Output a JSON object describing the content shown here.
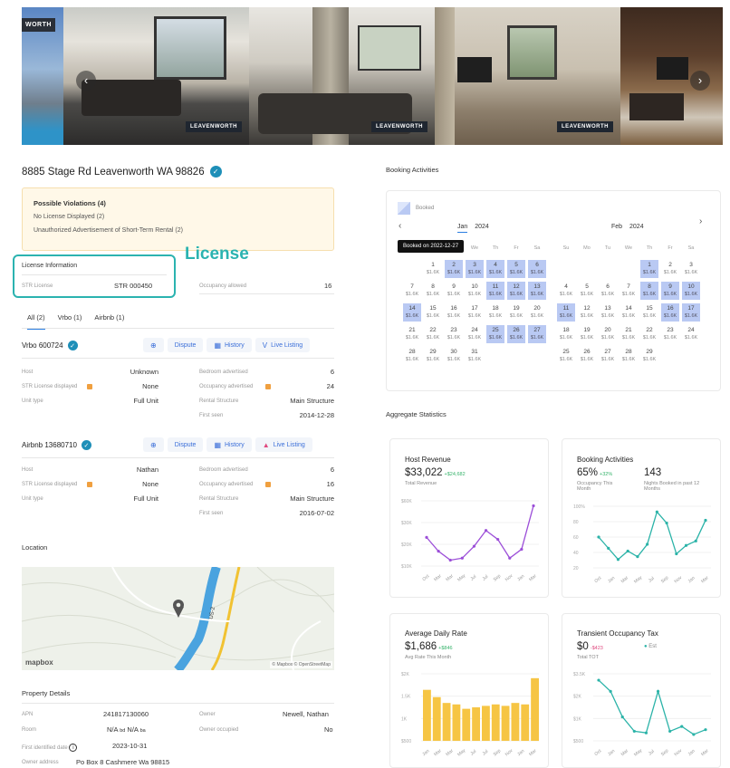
{
  "gallery": {
    "logo": "WORTH",
    "watermark": "LEAVENWORTH",
    "prev_icon": "chevron-left-icon",
    "next_icon": "chevron-right-icon"
  },
  "property": {
    "address": "8885 Stage Rd Leavenworth WA 98826"
  },
  "violations": {
    "title": "Possible Violations (4)",
    "items": [
      "No License Displayed (2)",
      "Unauthorized Advertisement of Short-Term Rental (2)"
    ]
  },
  "license_info": {
    "title": "License Information",
    "callout": "License",
    "str_license_label": "STR License",
    "str_license_value": "STR 000450",
    "occupancy_label": "Occupancy allowed",
    "occupancy_value": "16"
  },
  "tabs": [
    {
      "label": "All (2)"
    },
    {
      "label": "Vrbo (1)"
    },
    {
      "label": "Airbnb (1)"
    }
  ],
  "listings": [
    {
      "title": "Vrbo 600724",
      "buttons": {
        "dispute": "Dispute",
        "history": "History",
        "live": "Live Listing"
      },
      "left": [
        {
          "label": "Host",
          "value": "Unknown"
        },
        {
          "label": "STR License displayed",
          "value": "None"
        },
        {
          "label": "Unit type",
          "value": "Full Unit"
        }
      ],
      "right": [
        {
          "label": "Bedroom advertised",
          "value": "6"
        },
        {
          "label": "Occupancy advertised",
          "value": "24"
        },
        {
          "label": "Rental Structure",
          "value": "Main Structure"
        },
        {
          "label": "First seen",
          "value": "2014-12-28"
        }
      ]
    },
    {
      "title": "Airbnb 13680710",
      "buttons": {
        "dispute": "Dispute",
        "history": "History",
        "live": "Live Listing"
      },
      "left": [
        {
          "label": "Host",
          "value": "Nathan"
        },
        {
          "label": "STR License displayed",
          "value": "None"
        },
        {
          "label": "Unit type",
          "value": "Full Unit"
        }
      ],
      "right": [
        {
          "label": "Bedroom advertised",
          "value": "6"
        },
        {
          "label": "Occupancy advertised",
          "value": "16"
        },
        {
          "label": "Rental Structure",
          "value": "Main Structure"
        },
        {
          "label": "First seen",
          "value": "2016-07-02"
        }
      ]
    }
  ],
  "location": {
    "title": "Location",
    "map_logo": "mapbox",
    "attribution": "© Mapbox © OpenStreetMap",
    "road_label": "US-2"
  },
  "property_details": {
    "title": "Property Details",
    "apn_label": "APN",
    "apn_value": "241817130060",
    "owner_label": "Owner",
    "owner_value": "Newell, Nathan",
    "room_label": "Room",
    "room_value_bd": "N/A",
    "room_bd_unit": "bd",
    "room_value_ba": "N/A",
    "room_ba_unit": "ba",
    "owner_occupied_label": "Owner occupied",
    "owner_occupied_value": "No",
    "first_identified_label": "First identified date",
    "first_identified_value": "2023-10-31",
    "owner_address_label": "Owner address",
    "owner_address_value": "Po Box 8 Cashmere Wa 98815"
  },
  "booking": {
    "title": "Booking Activities",
    "legend": "Booked",
    "tooltip": "Booked on 2022-12-27",
    "months": [
      {
        "label": "Jan",
        "year": "2024"
      },
      {
        "label": "Feb",
        "year": "2024"
      }
    ],
    "weekdays": [
      "Su",
      "Mo",
      "Tu",
      "We",
      "Th",
      "Fr",
      "Sa"
    ],
    "price": "$1.6K",
    "jan_booked": [
      2,
      3,
      4,
      5,
      6,
      11,
      12,
      13,
      14,
      25,
      26,
      27
    ],
    "feb_booked": [
      1,
      8,
      9,
      10,
      11,
      16,
      17
    ],
    "colors": {
      "booked": "#b9c9f3"
    }
  },
  "aggregate": {
    "title": "Aggregate Statistics",
    "host_revenue": {
      "title": "Host Revenue",
      "value": "$33,022",
      "delta": "+$24,682",
      "sub": "Total Revenue"
    },
    "booking_activities": {
      "title": "Booking Activities",
      "occ_value": "65%",
      "occ_delta": "+32%",
      "occ_sub": "Occupancy This Month",
      "nights_value": "143",
      "nights_sub": "Nights Booked in past 12 Months"
    },
    "adr": {
      "title": "Average Daily Rate",
      "value": "$1,686",
      "delta": "+$846",
      "sub": "Avg Rate This Month"
    },
    "tot": {
      "title": "Transient Occupancy Tax",
      "value": "$0",
      "delta": "-$423",
      "legend": "Est",
      "sub": "Total TOT"
    }
  },
  "chart_data": [
    {
      "type": "line",
      "title": "Host Revenue",
      "categories": [
        "Oct",
        "Mar",
        "Mar",
        "May",
        "Jul",
        "Jul",
        "Sep",
        "Nov",
        "Jan",
        "Mar"
      ],
      "values": [
        29,
        15,
        6,
        8,
        20,
        36,
        27,
        8,
        17,
        61
      ],
      "y_ticks": [
        "$60K",
        "$30K",
        "$20K",
        "$10K"
      ],
      "color": "#9c4fd8"
    },
    {
      "type": "line",
      "title": "Booking Activities",
      "categories": [
        "Oct",
        "Jan",
        "Mar",
        "May",
        "Jul",
        "Sep",
        "Nov",
        "Jan",
        "Mar"
      ],
      "values": [
        55,
        35,
        15,
        30,
        20,
        42,
        100,
        80,
        25,
        40,
        48,
        85
      ],
      "y_ticks": [
        "100%",
        "80",
        "60",
        "40",
        "20"
      ],
      "color": "#2bb3a8"
    },
    {
      "type": "bar",
      "title": "Average Daily Rate",
      "categories": [
        "Jan",
        "Mar",
        "Mar",
        "May",
        "Jul",
        "Jul",
        "Sep",
        "Nov",
        "Jan",
        "Mar"
      ],
      "values": [
        1750,
        1500,
        1300,
        1250,
        1100,
        1150,
        1200,
        1250,
        1200,
        1300,
        1250,
        2150
      ],
      "y_ticks": [
        "$2K",
        "1.5K",
        "1K",
        "$500"
      ],
      "color": "#f6c544"
    },
    {
      "type": "line",
      "title": "Transient Occupancy Tax",
      "categories": [
        "Oct",
        "Jan",
        "Mar",
        "May",
        "Jul",
        "Sep",
        "Nov",
        "Jan",
        "Mar"
      ],
      "values": [
        3800,
        3100,
        1500,
        600,
        500,
        3100,
        600,
        900,
        400,
        700
      ],
      "y_ticks": [
        "$3.5K",
        "$2K",
        "$1K",
        "$500"
      ],
      "color": "#2bb3a8"
    }
  ]
}
